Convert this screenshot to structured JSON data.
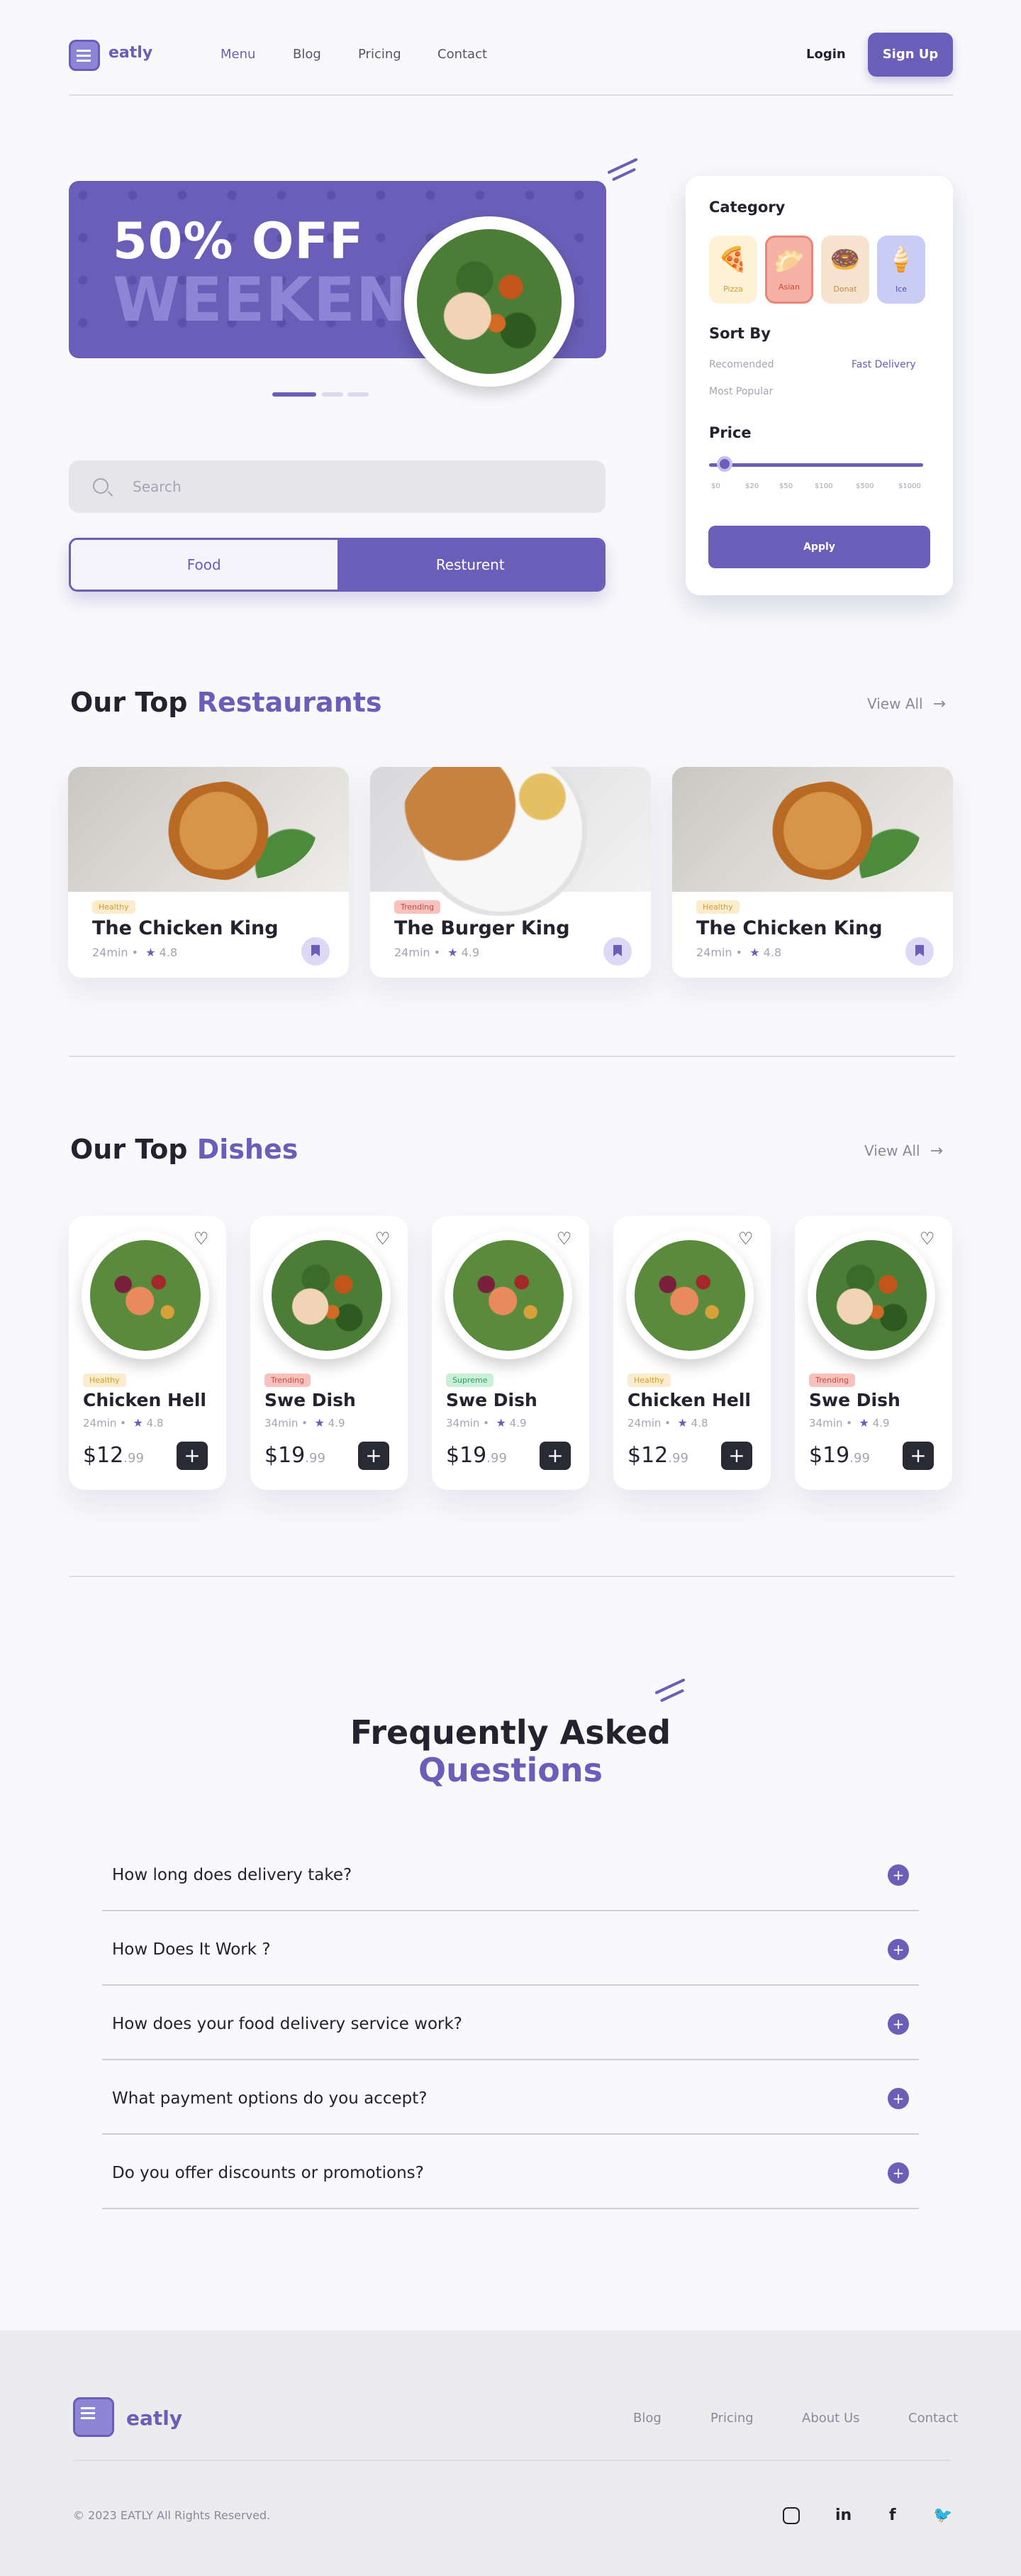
{
  "brand": {
    "name": "eatly"
  },
  "nav": {
    "links": [
      "Menu",
      "Blog",
      "Pricing",
      "Contact"
    ],
    "login": "Login",
    "signup": "Sign Up"
  },
  "hero": {
    "line1": "50% OFF",
    "line2": "WEEKEND"
  },
  "filter": {
    "category_title": "Category",
    "categories": [
      {
        "label": "Pizza",
        "icon": "pizza-icon"
      },
      {
        "label": "Asian",
        "icon": "asian-icon"
      },
      {
        "label": "Donat",
        "icon": "donut-icon"
      },
      {
        "label": "Ice",
        "icon": "ice-cream-icon"
      }
    ],
    "sort_title": "Sort By",
    "sort_options": [
      "Recomended",
      "Fast Delivery",
      "Most Popular"
    ],
    "price_title": "Price",
    "price_ticks": [
      "$0",
      "$20",
      "$50",
      "$100",
      "$500",
      "$1000"
    ],
    "price_value": 0.15,
    "apply": "Apply"
  },
  "search": {
    "placeholder": "Search"
  },
  "toggle": {
    "food": "Food",
    "restaurant": "Resturent"
  },
  "restaurants": {
    "title_plain": "Our Top",
    "title_accent": "Restaurants",
    "view_all": "View All",
    "items": [
      {
        "badge": "Healthy",
        "name": "The Chicken King",
        "time": "24min •",
        "rating": "4.8"
      },
      {
        "badge": "Trending",
        "name": "The Burger King",
        "time": "24min •",
        "rating": "4.9"
      },
      {
        "badge": "Healthy",
        "name": "The Chicken King",
        "time": "24min •",
        "rating": "4.8"
      }
    ]
  },
  "dishes": {
    "title_plain": "Our Top",
    "title_accent": "Dishes",
    "view_all": "View All",
    "items": [
      {
        "badge": "Healthy",
        "name": "Chicken Hell",
        "time": "24min •",
        "rating": "4.8",
        "price": "$12",
        "cents": ".99"
      },
      {
        "badge": "Trending",
        "name": "Swe Dish",
        "time": "34min •",
        "rating": "4.9",
        "price": "$19",
        "cents": ".99"
      },
      {
        "badge": "Supreme",
        "name": "Swe Dish",
        "time": "34min •",
        "rating": "4.9",
        "price": "$19",
        "cents": ".99"
      },
      {
        "badge": "Healthy",
        "name": "Chicken Hell",
        "time": "24min •",
        "rating": "4.8",
        "price": "$12",
        "cents": ".99"
      },
      {
        "badge": "Trending",
        "name": "Swe Dish",
        "time": "34min •",
        "rating": "4.9",
        "price": "$19",
        "cents": ".99"
      }
    ]
  },
  "faq": {
    "title_line1": "Frequently Asked",
    "title_line2": "Questions",
    "questions": [
      "How long does delivery take?",
      "How Does It Work ?",
      "How does your food delivery service work?",
      "What payment options do you accept?",
      "Do you offer discounts or promotions?"
    ]
  },
  "footer": {
    "links": [
      "Blog",
      "Pricing",
      "About Us",
      "Contact"
    ],
    "copyright": "© 2023 EATLY All Rights Reserved.",
    "social": [
      "instagram-icon",
      "linkedin-icon",
      "facebook-icon",
      "twitter-icon"
    ]
  },
  "colors": {
    "accent": "#6A5EB8",
    "dark": "#23222E",
    "muted": "#A5A4B0",
    "background": "#F9F9FB"
  }
}
